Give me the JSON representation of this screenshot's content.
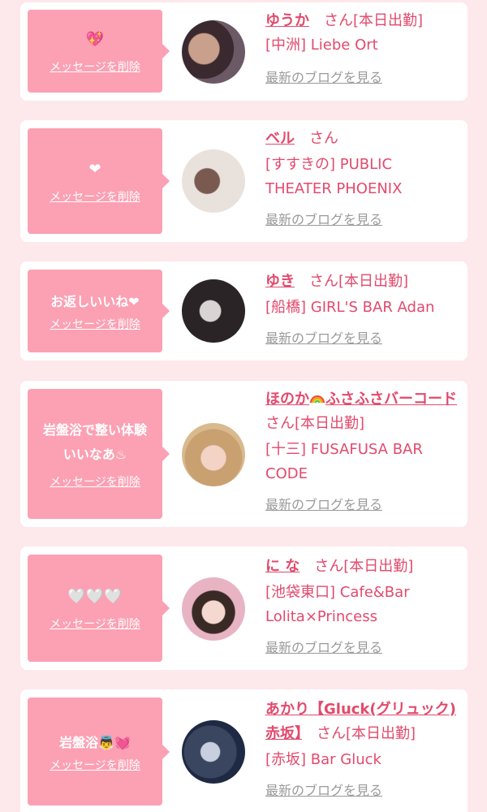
{
  "delete_label": "メッセージを削除",
  "san_label": "さん",
  "blog_label": "最新のブログを見る",
  "entries": [
    {
      "message": "💖",
      "name": "ゆうか",
      "status": "[本日出勤]",
      "shop": "[中洲] Liebe Ort"
    },
    {
      "message": "❤",
      "name": "ベル",
      "status": "",
      "shop": "[すすきの] PUBLIC THEATER PHOENIX"
    },
    {
      "message": "お返しいいね❤",
      "name": "ゆき",
      "status": "[本日出勤]",
      "shop": "[船橋] GIRL'S BAR Adan"
    },
    {
      "message": "岩盤浴で整い体験いいなあ♨",
      "name_part1": "ほのか",
      "name_part2": "ふさふさバーコード",
      "status": "[本日出勤]",
      "shop": "[十三] FUSAFUSA BAR CODE"
    },
    {
      "message": "🤍🤍🤍",
      "name": "に な",
      "status": "[本日出勤]",
      "shop": "[池袋東口] Cafe&Bar Lolita×Princess"
    },
    {
      "message": "岩盤浴👼💓",
      "name": "あかり【Gluck(グリュック)赤坂】",
      "status": "[本日出勤]",
      "shop": "[赤坂] Bar Gluck"
    }
  ]
}
